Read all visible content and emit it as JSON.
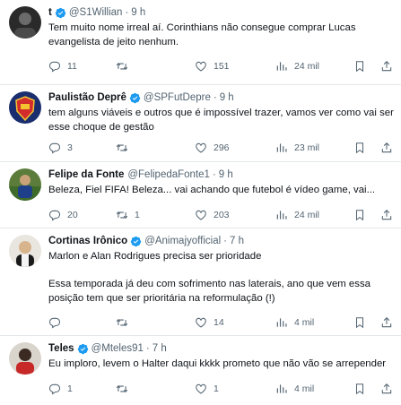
{
  "tweets": [
    {
      "name": "t",
      "handle": "@S1Willian",
      "time": "9 h",
      "text": "Tem muito nome irreal aí. Corinthians não consegue comprar Lucas\nevangelista de jeito nenhum.",
      "replies": "11",
      "retweets": "",
      "likes": "151",
      "views": "24 mil"
    },
    {
      "name": "Paulistão Deprê",
      "handle": "@SPFutDepre",
      "time": "9 h",
      "text": "tem alguns viáveis e outros que é impossível trazer, vamos ver como vai ser\nesse choque de gestão",
      "replies": "3",
      "retweets": "",
      "likes": "296",
      "views": "23 mil"
    },
    {
      "name": "Felipe da Fonte",
      "handle": "@FelipedaFonte1",
      "time": "9 h",
      "text": "Beleza, Fiel FIFA! Beleza... vai achando que futebol é vídeo game, vai...",
      "replies": "20",
      "retweets": "1",
      "likes": "203",
      "views": "24 mil"
    },
    {
      "name": "Cortinas Irônico",
      "handle": "@Animajyofficial",
      "time": "7 h",
      "text": "Marlon e Alan Rodrigues precisa ser prioridade\n\nEssa temporada já deu com sofrimento nas laterais, ano que vem essa\nposição tem que ser prioritária na reformulação (!)",
      "replies": "",
      "retweets": "",
      "likes": "14",
      "views": "4 mil"
    },
    {
      "name": "Teles",
      "handle": "@Mteles91",
      "time": "7 h",
      "text": "Eu imploro, levem o Halter daqui kkkk prometo que não vão se arrepender",
      "replies": "1",
      "retweets": "",
      "likes": "1",
      "views": "4 mil"
    }
  ],
  "icons": {
    "verified_color": "#1d9bf0",
    "action_color": "#536471"
  }
}
